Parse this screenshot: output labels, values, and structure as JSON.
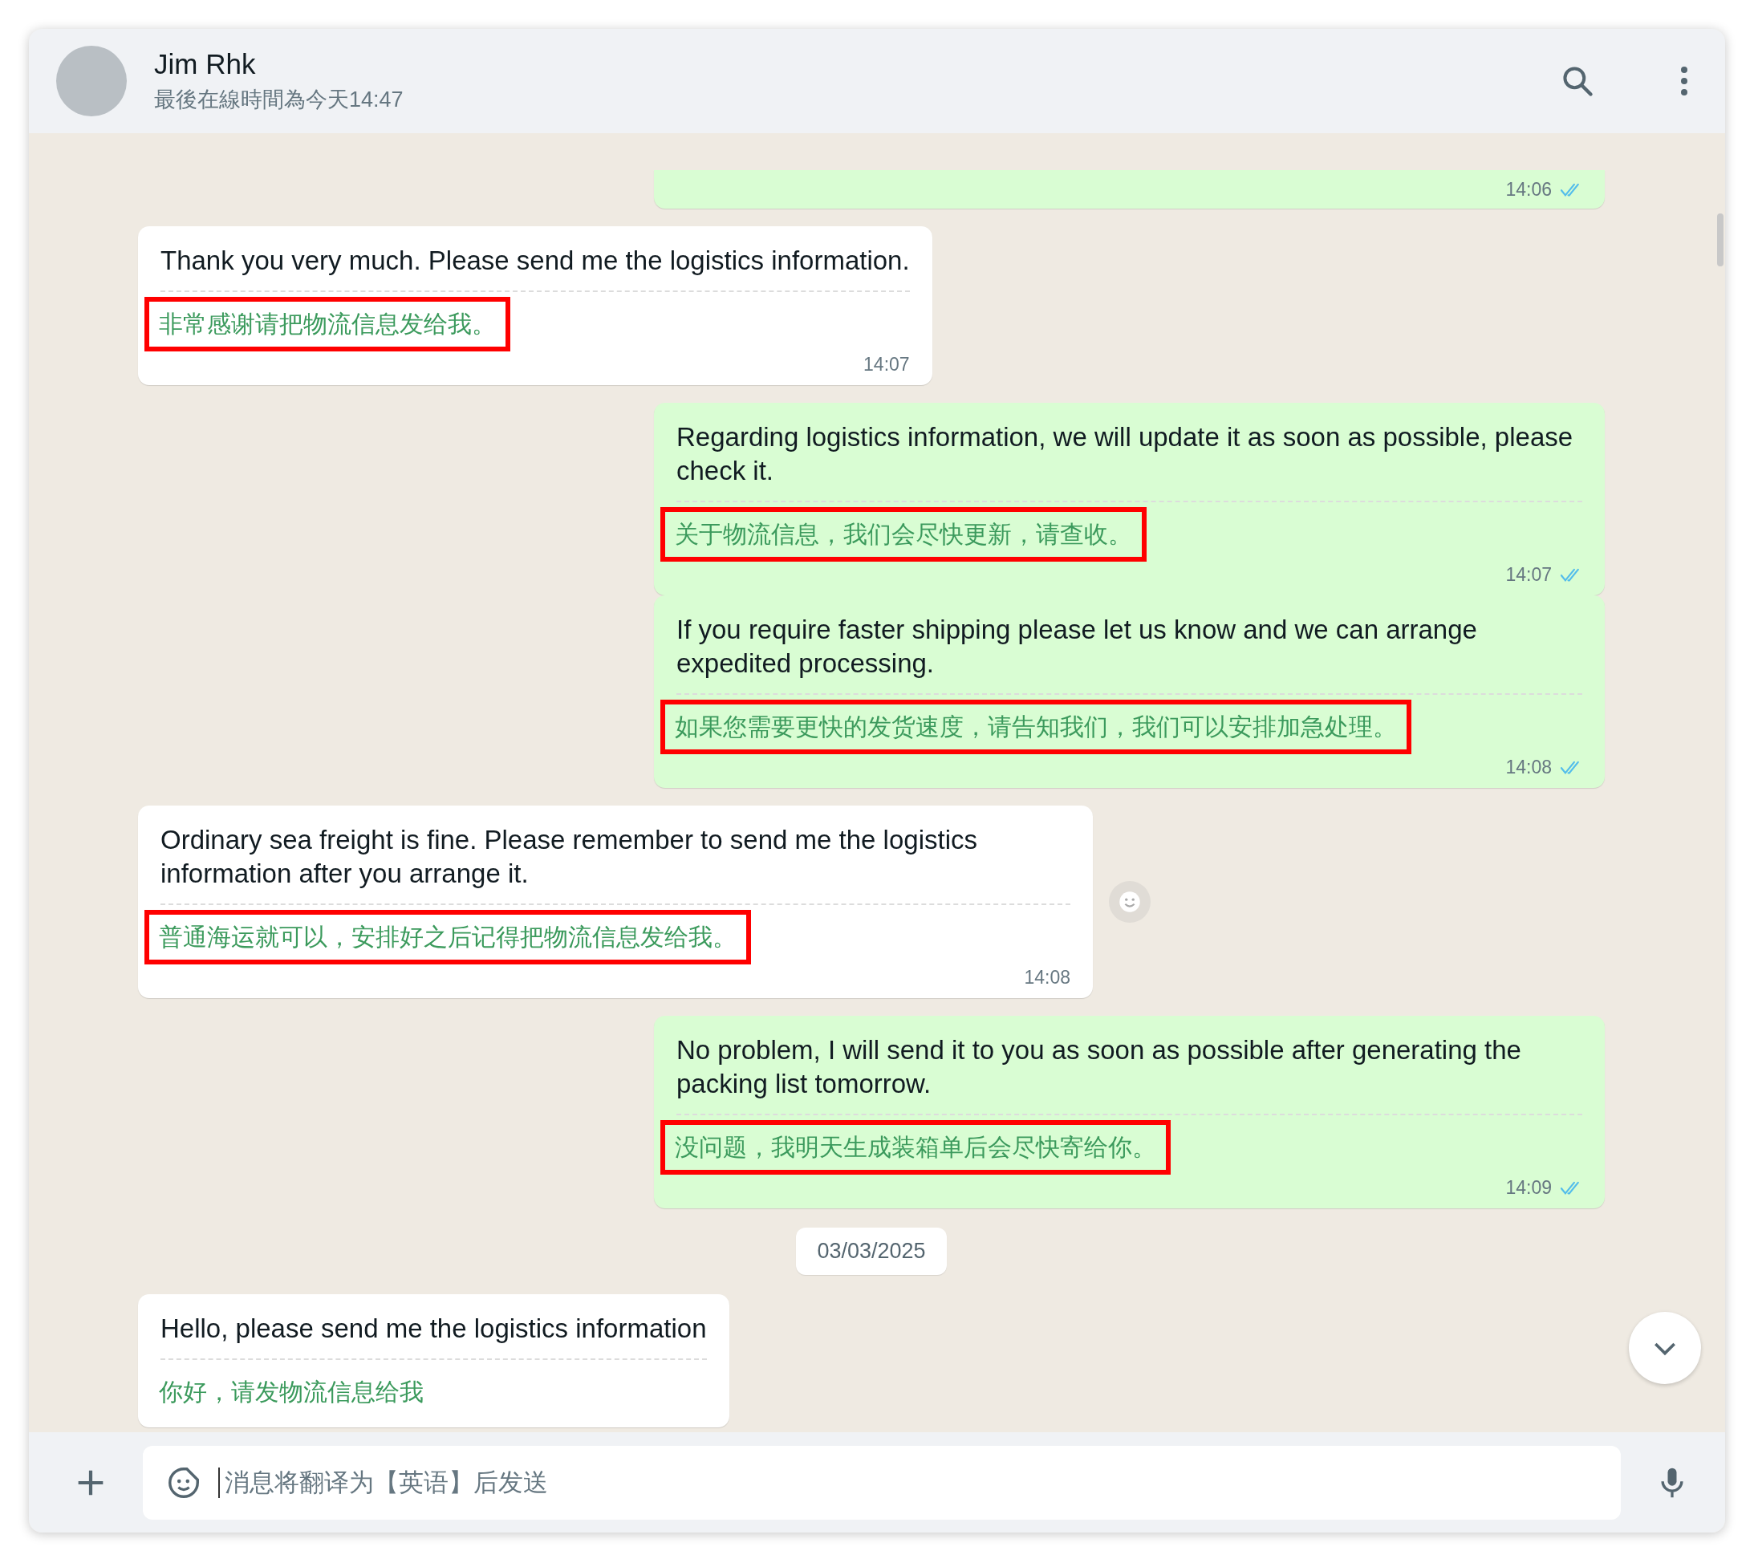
{
  "contact": {
    "name": "Jim Rhk",
    "status": "最後在線時間為今天14:47"
  },
  "messages": [
    {
      "kind": "outgoing",
      "time": "14:06",
      "read": true,
      "reaction": false
    },
    {
      "kind": "incoming",
      "text": "Thank you very much. Please send me the logistics information.",
      "translation": "非常感谢请把物流信息发给我。",
      "highlighted": true,
      "time": "14:07",
      "reaction": false
    },
    {
      "kind": "outgoing",
      "text": "Regarding logistics information, we will update it as soon as possible, please check it.",
      "translation": "关于物流信息，我们会尽快更新，请查收。",
      "highlighted": true,
      "time": "14:07",
      "read": true,
      "reaction": false
    },
    {
      "kind": "outgoing",
      "text": "If you require faster shipping please let us know and we can arrange expedited processing.",
      "translation": "如果您需要更快的发货速度，请告知我们，我们可以安排加急处理。",
      "highlighted": true,
      "time": "14:08",
      "read": true,
      "reaction": false
    },
    {
      "kind": "incoming",
      "text": "Ordinary sea freight is fine. Please remember to send me the logistics information after you arrange it.",
      "translation": "普通海运就可以，安排好之后记得把物流信息发给我。",
      "highlighted": true,
      "time": "14:08",
      "reaction": true
    },
    {
      "kind": "outgoing",
      "text": "No problem, I will send it to you as soon as possible after generating the packing list tomorrow.",
      "translation": "没问题，我明天生成装箱单后会尽快寄给你。",
      "highlighted": true,
      "time": "14:09",
      "read": true,
      "reaction": false
    },
    {
      "kind": "date",
      "text": "03/03/2025"
    },
    {
      "kind": "incoming",
      "text": "Hello, please send me the logistics information",
      "translation": "你好，请发物流信息给我",
      "highlighted": false,
      "reaction": false
    }
  ],
  "composer": {
    "placeholder": "消息将翻译为【英语】后发送"
  }
}
